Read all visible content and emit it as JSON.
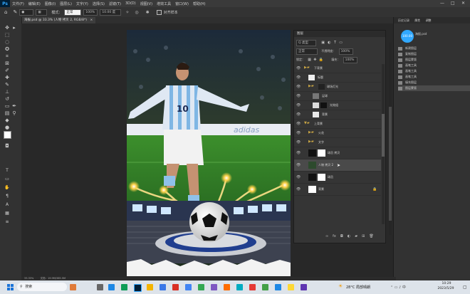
{
  "app": {
    "logo": "Ps",
    "menu": [
      "文件(F)",
      "编辑(E)",
      "图像(I)",
      "图层(L)",
      "文字(Y)",
      "选择(S)",
      "滤镜(T)",
      "3D(D)",
      "视图(V)",
      "增效工具",
      "窗口(W)",
      "帮助(H)"
    ],
    "window_controls": [
      "—",
      "□",
      "✕"
    ]
  },
  "options": {
    "mode_label": "模式：",
    "mode_value": "正常",
    "opacity_value": "100%",
    "flow_value": "10.00 度",
    "align_label": "对齐样本"
  },
  "document": {
    "tab_title": "海报.psd @ 33.3% (人物 拷贝 2, RGB/8*)"
  },
  "layers_panel": {
    "title": "图层",
    "kind_label": "Q 类型",
    "blend_mode": "正常",
    "opacity_label": "不透明度：",
    "opacity_value": "100%",
    "fill_label": "填充：",
    "fill_value": "100%",
    "lock_label": "锁定：",
    "layers": [
      {
        "name": "下背景",
        "type": "group"
      },
      {
        "name": "标题",
        "type": "layer"
      },
      {
        "name": "球场灯光",
        "type": "group"
      },
      {
        "name": "足球",
        "type": "layer"
      },
      {
        "name": "光效组",
        "type": "layer"
      },
      {
        "name": "背景",
        "type": "layer"
      },
      {
        "name": "上背景",
        "type": "group"
      },
      {
        "name": "火花",
        "type": "layer"
      },
      {
        "name": "文字",
        "type": "layer"
      },
      {
        "name": "球员 拷贝",
        "type": "layer"
      },
      {
        "name": "人物 拷贝 2",
        "type": "layer",
        "selected": true
      },
      {
        "name": "球员",
        "type": "layer"
      },
      {
        "name": "背景",
        "type": "background"
      }
    ]
  },
  "history_panel": {
    "tabs": [
      "历史记录",
      "属性",
      "调整"
    ],
    "snapshot": "海报.psd",
    "items": [
      "新建图层",
      "复制图层",
      "图层蒙版",
      "画笔工具",
      "画笔工具",
      "画笔工具",
      "填充图层",
      "图层蒙版"
    ],
    "badge": "100.00"
  },
  "status": {
    "zoom": "33.33%",
    "doc_size": "文档：19.9M/385.5M"
  },
  "poster": {
    "banner_text": "adidas",
    "jersey_number": "10"
  },
  "taskbar": {
    "search_label": "搜索",
    "weather": "28°C 局部晴朗",
    "time": "10:29",
    "date": "2023/5/29"
  },
  "colors": {
    "accent": "#31a8ff",
    "selected_layer": "#4a4a4a",
    "taskbar_bg": "#dde3ea",
    "panel_bg": "#353535"
  }
}
